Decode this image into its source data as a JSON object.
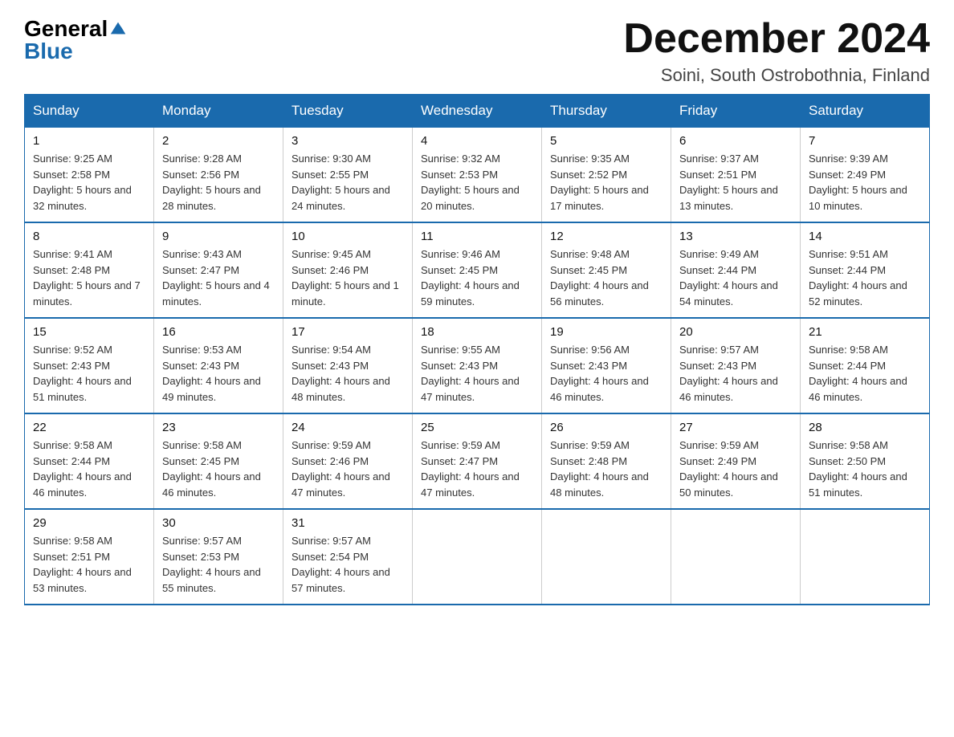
{
  "header": {
    "logo_general": "General",
    "logo_blue": "Blue",
    "month_title": "December 2024",
    "location": "Soini, South Ostrobothnia, Finland"
  },
  "days_of_week": [
    "Sunday",
    "Monday",
    "Tuesday",
    "Wednesday",
    "Thursday",
    "Friday",
    "Saturday"
  ],
  "weeks": [
    [
      {
        "day": "1",
        "sunrise": "9:25 AM",
        "sunset": "2:58 PM",
        "daylight": "5 hours and 32 minutes."
      },
      {
        "day": "2",
        "sunrise": "9:28 AM",
        "sunset": "2:56 PM",
        "daylight": "5 hours and 28 minutes."
      },
      {
        "day": "3",
        "sunrise": "9:30 AM",
        "sunset": "2:55 PM",
        "daylight": "5 hours and 24 minutes."
      },
      {
        "day": "4",
        "sunrise": "9:32 AM",
        "sunset": "2:53 PM",
        "daylight": "5 hours and 20 minutes."
      },
      {
        "day": "5",
        "sunrise": "9:35 AM",
        "sunset": "2:52 PM",
        "daylight": "5 hours and 17 minutes."
      },
      {
        "day": "6",
        "sunrise": "9:37 AM",
        "sunset": "2:51 PM",
        "daylight": "5 hours and 13 minutes."
      },
      {
        "day": "7",
        "sunrise": "9:39 AM",
        "sunset": "2:49 PM",
        "daylight": "5 hours and 10 minutes."
      }
    ],
    [
      {
        "day": "8",
        "sunrise": "9:41 AM",
        "sunset": "2:48 PM",
        "daylight": "5 hours and 7 minutes."
      },
      {
        "day": "9",
        "sunrise": "9:43 AM",
        "sunset": "2:47 PM",
        "daylight": "5 hours and 4 minutes."
      },
      {
        "day": "10",
        "sunrise": "9:45 AM",
        "sunset": "2:46 PM",
        "daylight": "5 hours and 1 minute."
      },
      {
        "day": "11",
        "sunrise": "9:46 AM",
        "sunset": "2:45 PM",
        "daylight": "4 hours and 59 minutes."
      },
      {
        "day": "12",
        "sunrise": "9:48 AM",
        "sunset": "2:45 PM",
        "daylight": "4 hours and 56 minutes."
      },
      {
        "day": "13",
        "sunrise": "9:49 AM",
        "sunset": "2:44 PM",
        "daylight": "4 hours and 54 minutes."
      },
      {
        "day": "14",
        "sunrise": "9:51 AM",
        "sunset": "2:44 PM",
        "daylight": "4 hours and 52 minutes."
      }
    ],
    [
      {
        "day": "15",
        "sunrise": "9:52 AM",
        "sunset": "2:43 PM",
        "daylight": "4 hours and 51 minutes."
      },
      {
        "day": "16",
        "sunrise": "9:53 AM",
        "sunset": "2:43 PM",
        "daylight": "4 hours and 49 minutes."
      },
      {
        "day": "17",
        "sunrise": "9:54 AM",
        "sunset": "2:43 PM",
        "daylight": "4 hours and 48 minutes."
      },
      {
        "day": "18",
        "sunrise": "9:55 AM",
        "sunset": "2:43 PM",
        "daylight": "4 hours and 47 minutes."
      },
      {
        "day": "19",
        "sunrise": "9:56 AM",
        "sunset": "2:43 PM",
        "daylight": "4 hours and 46 minutes."
      },
      {
        "day": "20",
        "sunrise": "9:57 AM",
        "sunset": "2:43 PM",
        "daylight": "4 hours and 46 minutes."
      },
      {
        "day": "21",
        "sunrise": "9:58 AM",
        "sunset": "2:44 PM",
        "daylight": "4 hours and 46 minutes."
      }
    ],
    [
      {
        "day": "22",
        "sunrise": "9:58 AM",
        "sunset": "2:44 PM",
        "daylight": "4 hours and 46 minutes."
      },
      {
        "day": "23",
        "sunrise": "9:58 AM",
        "sunset": "2:45 PM",
        "daylight": "4 hours and 46 minutes."
      },
      {
        "day": "24",
        "sunrise": "9:59 AM",
        "sunset": "2:46 PM",
        "daylight": "4 hours and 47 minutes."
      },
      {
        "day": "25",
        "sunrise": "9:59 AM",
        "sunset": "2:47 PM",
        "daylight": "4 hours and 47 minutes."
      },
      {
        "day": "26",
        "sunrise": "9:59 AM",
        "sunset": "2:48 PM",
        "daylight": "4 hours and 48 minutes."
      },
      {
        "day": "27",
        "sunrise": "9:59 AM",
        "sunset": "2:49 PM",
        "daylight": "4 hours and 50 minutes."
      },
      {
        "day": "28",
        "sunrise": "9:58 AM",
        "sunset": "2:50 PM",
        "daylight": "4 hours and 51 minutes."
      }
    ],
    [
      {
        "day": "29",
        "sunrise": "9:58 AM",
        "sunset": "2:51 PM",
        "daylight": "4 hours and 53 minutes."
      },
      {
        "day": "30",
        "sunrise": "9:57 AM",
        "sunset": "2:53 PM",
        "daylight": "4 hours and 55 minutes."
      },
      {
        "day": "31",
        "sunrise": "9:57 AM",
        "sunset": "2:54 PM",
        "daylight": "4 hours and 57 minutes."
      },
      null,
      null,
      null,
      null
    ]
  ]
}
